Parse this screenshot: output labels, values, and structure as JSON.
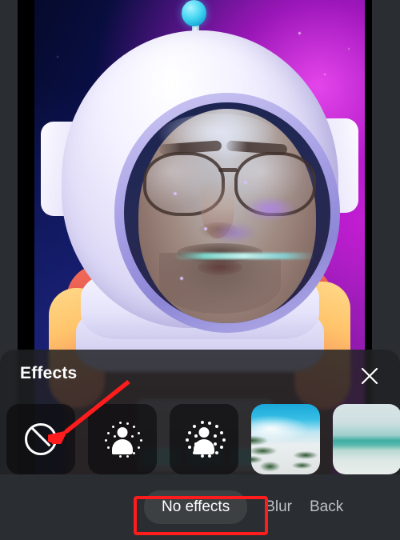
{
  "app": {
    "kind": "video-call-effects-picker",
    "panel_bg": "#202124",
    "tab_active_bg": "#3c4043",
    "annotation_color": "#ff1c1c"
  },
  "video": {
    "label": "self-view-video",
    "background_effect": "astronaut-avatar",
    "subject": "person wearing glasses inside astronaut helmet visor",
    "backdrop_colors": [
      "#060a2c",
      "#241067",
      "#c61fd0"
    ],
    "antenna_bulb_color": "#45d6f2"
  },
  "effects_panel": {
    "title": "Effects",
    "close_icon": "close-icon",
    "thumbnails": [
      {
        "id": "no-effects",
        "label": "No effects",
        "icon": "no-effects-icon",
        "selected": true
      },
      {
        "id": "slight-blur",
        "label": "Slightly blur your background",
        "icon": "slight-blur-icon",
        "selected": false
      },
      {
        "id": "blur",
        "label": "Blur your background",
        "icon": "blur-icon",
        "selected": false
      },
      {
        "id": "beach-palms",
        "label": "Beach with palm trees",
        "icon": "background-image",
        "selected": false
      },
      {
        "id": "beach-horizon",
        "label": "Beach horizon",
        "icon": "background-image",
        "selected": false
      }
    ]
  },
  "tabs": [
    {
      "id": "no-effects",
      "label": "No effects",
      "active": true
    },
    {
      "id": "blur",
      "label": "Blur",
      "active": false
    },
    {
      "id": "backgrounds",
      "label": "Back",
      "active": false
    }
  ],
  "annotations": [
    {
      "type": "arrow",
      "color": "#ff1c1c",
      "points_to": "no-effects-thumbnail"
    },
    {
      "type": "box",
      "color": "#ff1c1c",
      "surrounds": "no-effects-tab"
    }
  ]
}
